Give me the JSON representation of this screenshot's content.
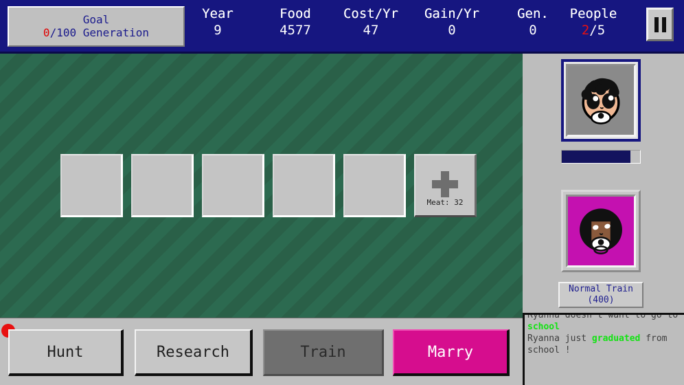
{
  "header": {
    "goal": {
      "title": "Goal",
      "progress_value": "0",
      "progress_rest": "/100 Generation"
    },
    "stats": [
      {
        "label": "Year",
        "value": "9"
      },
      {
        "label": "Food",
        "value": "4577"
      },
      {
        "label": "Cost/Yr",
        "value": "47"
      },
      {
        "label": "Gain/Yr",
        "value": "0"
      },
      {
        "label": "Gen.",
        "value": "0"
      },
      {
        "label": "People",
        "value_red": "2",
        "value_rest": "/5"
      }
    ],
    "pause_button": "pause-icon"
  },
  "field": {
    "slots": [
      {
        "type": "empty"
      },
      {
        "type": "empty"
      },
      {
        "type": "empty"
      },
      {
        "type": "empty"
      },
      {
        "type": "empty"
      }
    ],
    "add_slot": {
      "icon": "plus-icon",
      "label": "Meat: 32"
    }
  },
  "sidebar": {
    "selected_character": {
      "portrait": "baby-curly-hair-pacifier",
      "background_color": "#8a8a8a",
      "progress_percent": 88
    },
    "second_character": {
      "portrait": "adult-afro-pacifier",
      "background_color": "#c411b0",
      "action_label_line1": "Normal Train",
      "action_label_line2": "(400)"
    }
  },
  "log": {
    "lines": [
      {
        "clipped": true,
        "parts": [
          {
            "text": "Ryanna doesn't want to go to"
          }
        ]
      },
      {
        "clipped": false,
        "parts": [
          {
            "text": "school",
            "style": "green"
          }
        ]
      },
      {
        "clipped": false,
        "parts": [
          {
            "text": "Ryanna just "
          },
          {
            "text": "graduated",
            "style": "green"
          },
          {
            "text": " from"
          }
        ]
      },
      {
        "clipped": false,
        "parts": [
          {
            "text": "school !"
          }
        ]
      }
    ]
  },
  "actions": {
    "hunt": "Hunt",
    "research": "Research",
    "train": "Train",
    "marry": "Marry"
  },
  "colors": {
    "header_bg": "#161680",
    "field_green_light": "#2c6a50",
    "field_green_dark": "#2a6048",
    "accent_magenta": "#d60d8e",
    "alert_red": "#e81010",
    "log_green": "#12e312",
    "panel_gray": "#bdbdbd"
  }
}
